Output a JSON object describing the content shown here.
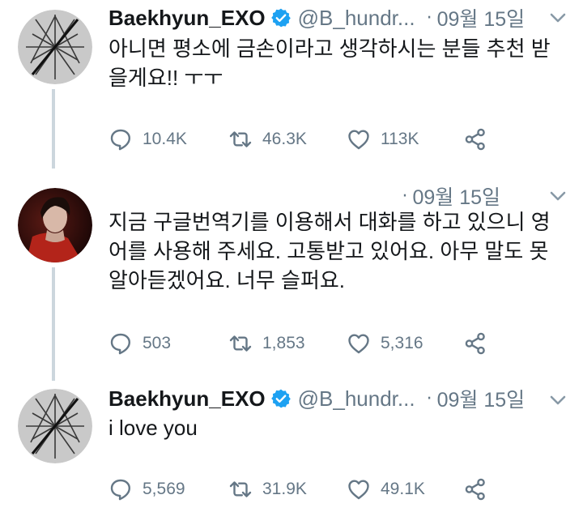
{
  "colors": {
    "text": "#14171a",
    "muted": "#657786",
    "verified": "#1da1f2",
    "thread_line": "#ccd6dd"
  },
  "icons": {
    "reply": "reply-icon",
    "retweet": "retweet-icon",
    "like": "heart-icon",
    "share": "share-icon",
    "verified": "verified-badge-icon",
    "more": "chevron-down-icon"
  },
  "tweets": [
    {
      "name": "Baekhyun_EXO",
      "handle": "@B_hundr...",
      "dot": "·",
      "date": "09월 15일",
      "text": "아니면 평소에 금손이라고 생각하시는 분들 추천 받을게요!! ㅜㅜ",
      "reply_count": "10.4K",
      "retweet_count": "46.3K",
      "like_count": "113K"
    },
    {
      "dot": "·",
      "date": "09월 15일",
      "text": "지금 구글번역기를 이용해서 대화를 하고 있으니 영어를 사용해 주세요. 고통받고 있어요. 아무 말도 못 알아듣겠어요. 너무 슬퍼요.",
      "reply_count": "503",
      "retweet_count": "1,853",
      "like_count": "5,316"
    },
    {
      "name": "Baekhyun_EXO",
      "handle": "@B_hundr...",
      "dot": "·",
      "date": "09월 15일",
      "text": "i love you",
      "reply_count": "5,569",
      "retweet_count": "31.9K",
      "like_count": "49.1K"
    }
  ]
}
